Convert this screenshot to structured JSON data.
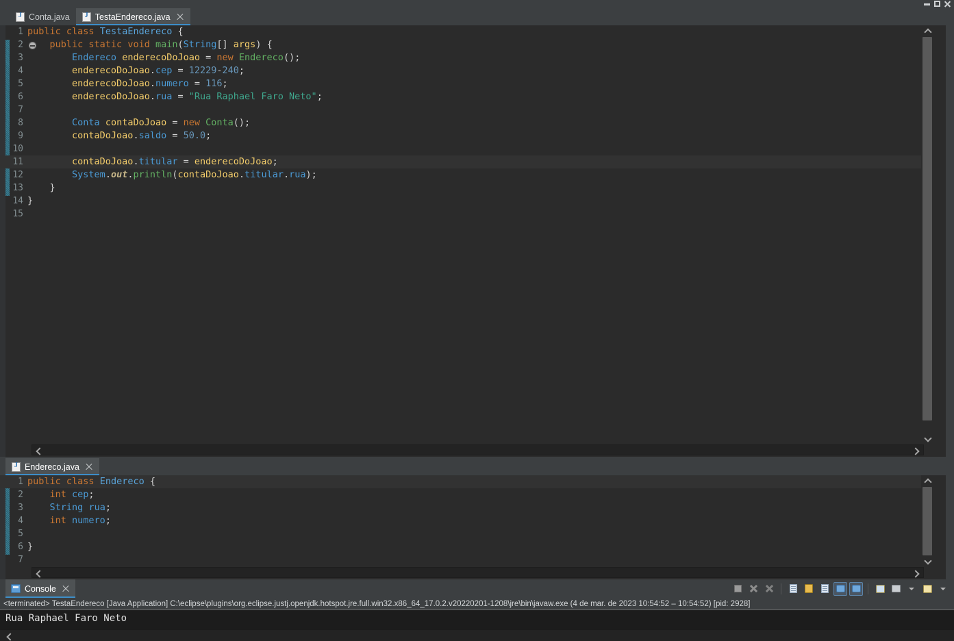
{
  "window": {
    "controls": [
      {
        "name": "minimize",
        "glyph": "minimize-icon"
      },
      {
        "name": "maximize",
        "glyph": "maximize-icon"
      },
      {
        "name": "close",
        "glyph": "close-icon"
      }
    ]
  },
  "colors": {
    "editor_bg": "#2b2b2b",
    "chrome_bg": "#3c3f41",
    "active_tab_bg": "#4e5254",
    "tab_underline": "#3d8ec9",
    "console_bg": "#1c1c1c",
    "keyword": "#cc7832",
    "type": "#4b9bd6",
    "field": "#4b9bd6",
    "local_var": "#f5ce6b",
    "method": "#63b163",
    "string": "#3fa88e",
    "number": "#6897bb",
    "line_number": "#838f92",
    "fold_bar": "#2d6f82"
  },
  "editor_top": {
    "tabs": [
      {
        "label": "Conta.java",
        "icon": "java-file-icon",
        "active": false,
        "closable": false
      },
      {
        "label": "TestaEndereco.java",
        "icon": "java-file-icon",
        "active": true,
        "closable": true
      }
    ],
    "highlighted_line": 11,
    "collapse_marker_line": 2,
    "fold_range": [
      2,
      13
    ],
    "lines": [
      {
        "n": 1,
        "tokens": [
          {
            "t": "public ",
            "c": "kw"
          },
          {
            "t": "class ",
            "c": "kw"
          },
          {
            "t": "TestaEndereco",
            "c": "cls"
          },
          {
            "t": " {",
            "c": "pun"
          }
        ]
      },
      {
        "n": 2,
        "tokens": [
          {
            "t": "    ",
            "c": "pun"
          },
          {
            "t": "public ",
            "c": "kw"
          },
          {
            "t": "static ",
            "c": "kw"
          },
          {
            "t": "void ",
            "c": "kw"
          },
          {
            "t": "main",
            "c": "mth"
          },
          {
            "t": "(",
            "c": "pun"
          },
          {
            "t": "String",
            "c": "typ"
          },
          {
            "t": "[] ",
            "c": "pun"
          },
          {
            "t": "args",
            "c": "var"
          },
          {
            "t": ") {",
            "c": "pun"
          }
        ]
      },
      {
        "n": 3,
        "tokens": [
          {
            "t": "        ",
            "c": "pun"
          },
          {
            "t": "Endereco",
            "c": "typ"
          },
          {
            "t": " ",
            "c": "pun"
          },
          {
            "t": "enderecoDoJoao",
            "c": "var"
          },
          {
            "t": " = ",
            "c": "pun"
          },
          {
            "t": "new ",
            "c": "kw"
          },
          {
            "t": "Endereco",
            "c": "mth"
          },
          {
            "t": "();",
            "c": "pun"
          }
        ]
      },
      {
        "n": 4,
        "tokens": [
          {
            "t": "        ",
            "c": "pun"
          },
          {
            "t": "enderecoDoJoao",
            "c": "var"
          },
          {
            "t": ".",
            "c": "pun"
          },
          {
            "t": "cep",
            "c": "fld"
          },
          {
            "t": " = ",
            "c": "pun"
          },
          {
            "t": "12229",
            "c": "num"
          },
          {
            "t": "-",
            "c": "pun"
          },
          {
            "t": "240",
            "c": "num"
          },
          {
            "t": ";",
            "c": "pun"
          }
        ]
      },
      {
        "n": 5,
        "tokens": [
          {
            "t": "        ",
            "c": "pun"
          },
          {
            "t": "enderecoDoJoao",
            "c": "var"
          },
          {
            "t": ".",
            "c": "pun"
          },
          {
            "t": "numero",
            "c": "fld"
          },
          {
            "t": " = ",
            "c": "pun"
          },
          {
            "t": "116",
            "c": "num"
          },
          {
            "t": ";",
            "c": "pun"
          }
        ]
      },
      {
        "n": 6,
        "tokens": [
          {
            "t": "        ",
            "c": "pun"
          },
          {
            "t": "enderecoDoJoao",
            "c": "var"
          },
          {
            "t": ".",
            "c": "pun"
          },
          {
            "t": "rua",
            "c": "fld"
          },
          {
            "t": " = ",
            "c": "pun"
          },
          {
            "t": "\"Rua Raphael Faro Neto\"",
            "c": "str"
          },
          {
            "t": ";",
            "c": "pun"
          }
        ]
      },
      {
        "n": 7,
        "tokens": []
      },
      {
        "n": 8,
        "tokens": [
          {
            "t": "        ",
            "c": "pun"
          },
          {
            "t": "Conta",
            "c": "typ"
          },
          {
            "t": " ",
            "c": "pun"
          },
          {
            "t": "contaDoJoao",
            "c": "var"
          },
          {
            "t": " = ",
            "c": "pun"
          },
          {
            "t": "new ",
            "c": "kw"
          },
          {
            "t": "Conta",
            "c": "mth"
          },
          {
            "t": "();",
            "c": "pun"
          }
        ]
      },
      {
        "n": 9,
        "tokens": [
          {
            "t": "        ",
            "c": "pun"
          },
          {
            "t": "contaDoJoao",
            "c": "var"
          },
          {
            "t": ".",
            "c": "pun"
          },
          {
            "t": "saldo",
            "c": "fld"
          },
          {
            "t": " = ",
            "c": "pun"
          },
          {
            "t": "50.0",
            "c": "num"
          },
          {
            "t": ";",
            "c": "pun"
          }
        ]
      },
      {
        "n": 10,
        "tokens": []
      },
      {
        "n": 11,
        "tokens": [
          {
            "t": "        ",
            "c": "pun"
          },
          {
            "t": "contaDoJoao",
            "c": "var"
          },
          {
            "t": ".",
            "c": "pun"
          },
          {
            "t": "titular",
            "c": "fld"
          },
          {
            "t": " = ",
            "c": "pun"
          },
          {
            "t": "enderecoDoJoao",
            "c": "var"
          },
          {
            "t": ";",
            "c": "pun"
          }
        ]
      },
      {
        "n": 12,
        "tokens": [
          {
            "t": "        ",
            "c": "pun"
          },
          {
            "t": "System",
            "c": "stat"
          },
          {
            "t": ".",
            "c": "pun"
          },
          {
            "t": "out",
            "c": "statf"
          },
          {
            "t": ".",
            "c": "pun"
          },
          {
            "t": "println",
            "c": "mth"
          },
          {
            "t": "(",
            "c": "pun"
          },
          {
            "t": "contaDoJoao",
            "c": "var"
          },
          {
            "t": ".",
            "c": "pun"
          },
          {
            "t": "titular",
            "c": "fld"
          },
          {
            "t": ".",
            "c": "pun"
          },
          {
            "t": "rua",
            "c": "fld"
          },
          {
            "t": ");",
            "c": "pun"
          }
        ]
      },
      {
        "n": 13,
        "tokens": [
          {
            "t": "    }",
            "c": "pun"
          }
        ]
      },
      {
        "n": 14,
        "tokens": [
          {
            "t": "}",
            "c": "pun"
          }
        ]
      },
      {
        "n": 15,
        "tokens": []
      }
    ]
  },
  "editor_bottom": {
    "tabs": [
      {
        "label": "Endereco.java",
        "icon": "java-file-icon",
        "active": true,
        "closable": true
      }
    ],
    "highlighted_line": 1,
    "fold_range": [
      1,
      6
    ],
    "lines": [
      {
        "n": 1,
        "tokens": [
          {
            "t": "public ",
            "c": "kw"
          },
          {
            "t": "class ",
            "c": "kw"
          },
          {
            "t": "Endereco",
            "c": "cls"
          },
          {
            "t": " {",
            "c": "pun"
          }
        ]
      },
      {
        "n": 2,
        "tokens": [
          {
            "t": "    ",
            "c": "pun"
          },
          {
            "t": "int ",
            "c": "kw"
          },
          {
            "t": "cep",
            "c": "fld"
          },
          {
            "t": ";",
            "c": "pun"
          }
        ]
      },
      {
        "n": 3,
        "tokens": [
          {
            "t": "    ",
            "c": "pun"
          },
          {
            "t": "String",
            "c": "typ"
          },
          {
            "t": " ",
            "c": "pun"
          },
          {
            "t": "rua",
            "c": "fld"
          },
          {
            "t": ";",
            "c": "pun"
          }
        ]
      },
      {
        "n": 4,
        "tokens": [
          {
            "t": "    ",
            "c": "pun"
          },
          {
            "t": "int ",
            "c": "kw"
          },
          {
            "t": "numero",
            "c": "fld"
          },
          {
            "t": ";",
            "c": "pun"
          }
        ]
      },
      {
        "n": 5,
        "tokens": []
      },
      {
        "n": 6,
        "tokens": [
          {
            "t": "}",
            "c": "pun"
          }
        ]
      },
      {
        "n": 7,
        "tokens": []
      }
    ]
  },
  "console": {
    "tab_label": "Console",
    "tab_icon": "console-icon",
    "command_line": "<terminated> TestaEndereco [Java Application] C:\\eclipse\\plugins\\org.eclipse.justj.openjdk.hotspot.jre.full.win32.x86_64_17.0.2.v20220201-1208\\jre\\bin\\javaw.exe  (4 de mar. de 2023 10:54:52 – 10:54:52) [pid: 2928]",
    "output": "Rua Raphael Faro Neto",
    "toolbar": [
      {
        "name": "terminate-button",
        "icon": "stop-square-icon",
        "enabled": false,
        "selected": false
      },
      {
        "name": "remove-launch-button",
        "icon": "remove-x-icon",
        "enabled": true,
        "selected": false
      },
      {
        "name": "remove-all-terminated-button",
        "icon": "remove-all-x-icon",
        "enabled": true,
        "selected": false
      },
      {
        "name": "separator-1",
        "icon": "separator",
        "enabled": false,
        "selected": false
      },
      {
        "name": "clear-console-button",
        "icon": "clear-console-icon",
        "enabled": true,
        "selected": false
      },
      {
        "name": "scroll-lock-button",
        "icon": "lock-icon",
        "enabled": true,
        "selected": false
      },
      {
        "name": "word-wrap-button",
        "icon": "word-wrap-icon",
        "enabled": true,
        "selected": false
      },
      {
        "name": "show-console-on-output-button",
        "icon": "show-console-icon",
        "enabled": true,
        "selected": true
      },
      {
        "name": "show-console-on-error-button",
        "icon": "show-console-error-icon",
        "enabled": true,
        "selected": true
      },
      {
        "name": "separator-2",
        "icon": "separator",
        "enabled": false,
        "selected": false
      },
      {
        "name": "pin-console-button",
        "icon": "pin-console-icon",
        "enabled": true,
        "selected": false
      },
      {
        "name": "display-selected-console-button",
        "icon": "display-console-icon",
        "enabled": true,
        "selected": false
      },
      {
        "name": "display-selected-console-dropdown",
        "icon": "chevron-down-icon",
        "enabled": true,
        "selected": false
      },
      {
        "name": "open-console-button",
        "icon": "open-console-icon",
        "enabled": true,
        "selected": false
      },
      {
        "name": "open-console-dropdown",
        "icon": "chevron-down-icon",
        "enabled": true,
        "selected": false
      }
    ]
  }
}
